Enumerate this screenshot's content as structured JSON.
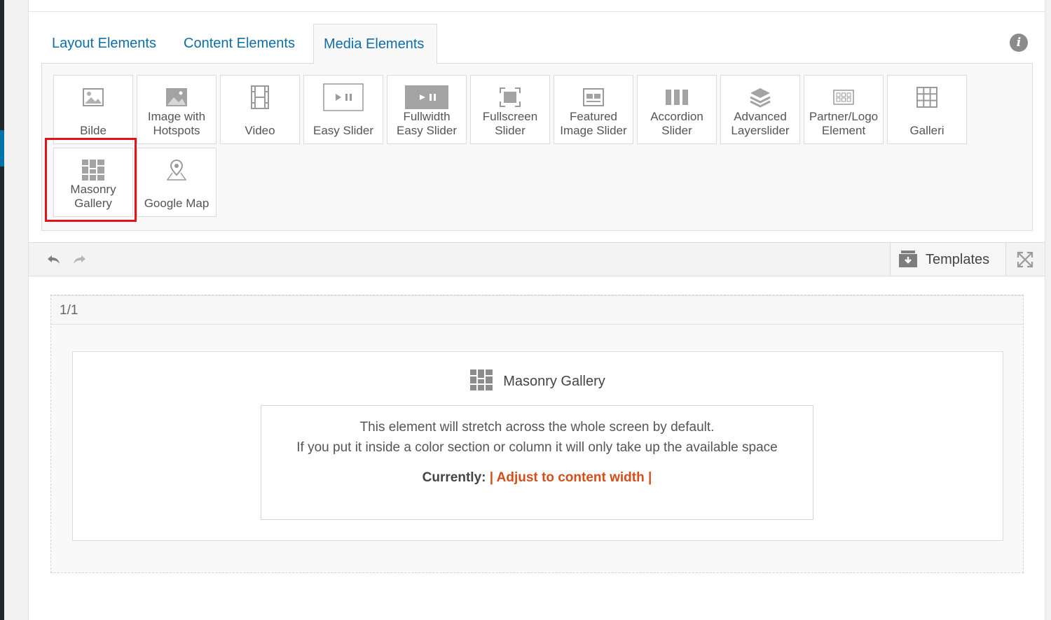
{
  "tabs": [
    {
      "label": "Layout Elements",
      "active": false
    },
    {
      "label": "Content Elements",
      "active": false
    },
    {
      "label": "Media Elements",
      "active": true
    }
  ],
  "info_icon": "info-icon",
  "elements": [
    {
      "line1": "",
      "line2": "Bilde",
      "icon": "image-icon"
    },
    {
      "line1": "Image with",
      "line2": "Hotspots",
      "icon": "image-hotspots-icon"
    },
    {
      "line1": "",
      "line2": "Video",
      "icon": "film-icon"
    },
    {
      "line1": "",
      "line2": "Easy Slider",
      "icon": "slider-icon"
    },
    {
      "line1": "Fullwidth",
      "line2": "Easy Slider",
      "icon": "fullwidth-slider-icon"
    },
    {
      "line1": "Fullscreen",
      "line2": "Slider",
      "icon": "fullscreen-icon"
    },
    {
      "line1": "Featured",
      "line2": "Image Slider",
      "icon": "featured-slider-icon"
    },
    {
      "line1": "Accordion",
      "line2": "Slider",
      "icon": "accordion-icon"
    },
    {
      "line1": "Advanced",
      "line2": "Layerslider",
      "icon": "layers-icon"
    },
    {
      "line1": "Partner/Logo",
      "line2": "Element",
      "icon": "logo-grid-icon"
    },
    {
      "line1": "",
      "line2": "Galleri",
      "icon": "grid-icon"
    },
    {
      "line1": "Masonry",
      "line2": "Gallery",
      "icon": "masonry-icon",
      "highlighted": true
    },
    {
      "line1": "",
      "line2": "Google Map",
      "icon": "map-pin-icon"
    }
  ],
  "toolbar": {
    "undo_icon": "undo-icon",
    "redo_icon": "redo-icon",
    "templates_label": "Templates",
    "templates_icon": "templates-box-icon",
    "expand_icon": "expand-icon"
  },
  "canvas": {
    "column_label": "1/1",
    "element_title": "Masonry Gallery",
    "element_icon": "masonry-icon",
    "note_line1": "This element will stretch across the whole screen by default.",
    "note_line2": "If you put it inside a color section or column it will only take up the available space",
    "current_label": "Currently:",
    "current_value": "| Adjust to content width |"
  },
  "colors": {
    "tab_text": "#0f6ea6",
    "highlight": "#e0151b",
    "current_value": "#d54e1a"
  }
}
